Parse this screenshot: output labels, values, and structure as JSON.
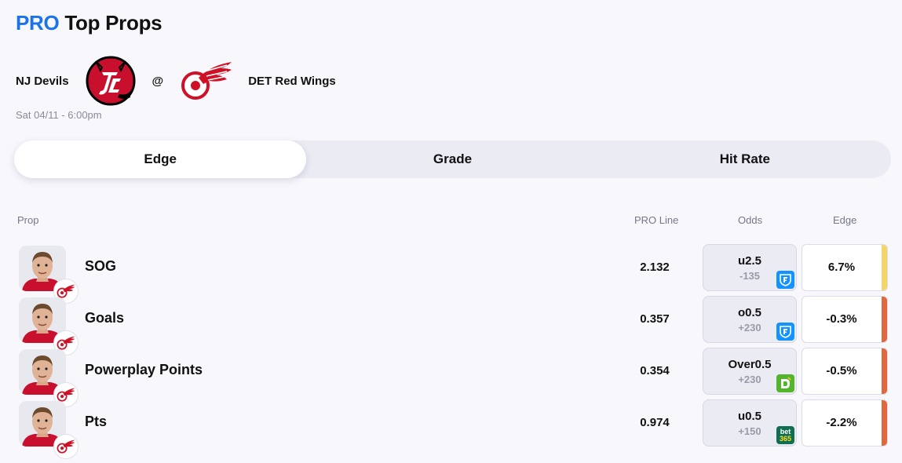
{
  "header": {
    "pro": "PRO",
    "title": "Top Props"
  },
  "matchup": {
    "away_team": "NJ Devils",
    "separator": "@",
    "home_team": "DET Red Wings",
    "datetime": "Sat 04/11 - 6:00pm"
  },
  "tabs": [
    {
      "label": "Edge",
      "active": true
    },
    {
      "label": "Grade",
      "active": false
    },
    {
      "label": "Hit Rate",
      "active": false
    }
  ],
  "columns": {
    "prop": "Prop",
    "pro_line": "PRO Line",
    "odds": "Odds",
    "edge": "Edge"
  },
  "rows": [
    {
      "prop": "SOG",
      "pro_line": "2.132",
      "odds_line": "u2.5",
      "odds_price": "-135",
      "book": "fanduel-icon",
      "edge": "6.7%",
      "edge_color": "#f5d565"
    },
    {
      "prop": "Goals",
      "pro_line": "0.357",
      "odds_line": "o0.5",
      "odds_price": "+230",
      "book": "fanduel-icon",
      "edge": "-0.3%",
      "edge_color": "#e0683f"
    },
    {
      "prop": "Powerplay Points",
      "pro_line": "0.354",
      "odds_line": "Over0.5",
      "odds_price": "+230",
      "book": "draftkings-icon",
      "edge": "-0.5%",
      "edge_color": "#e0683f"
    },
    {
      "prop": "Pts",
      "pro_line": "0.974",
      "odds_line": "u0.5",
      "odds_price": "+150",
      "book": "bet365-icon",
      "book_text": [
        "bet",
        "365"
      ],
      "edge": "-2.2%",
      "edge_color": "#e0683f"
    }
  ]
}
